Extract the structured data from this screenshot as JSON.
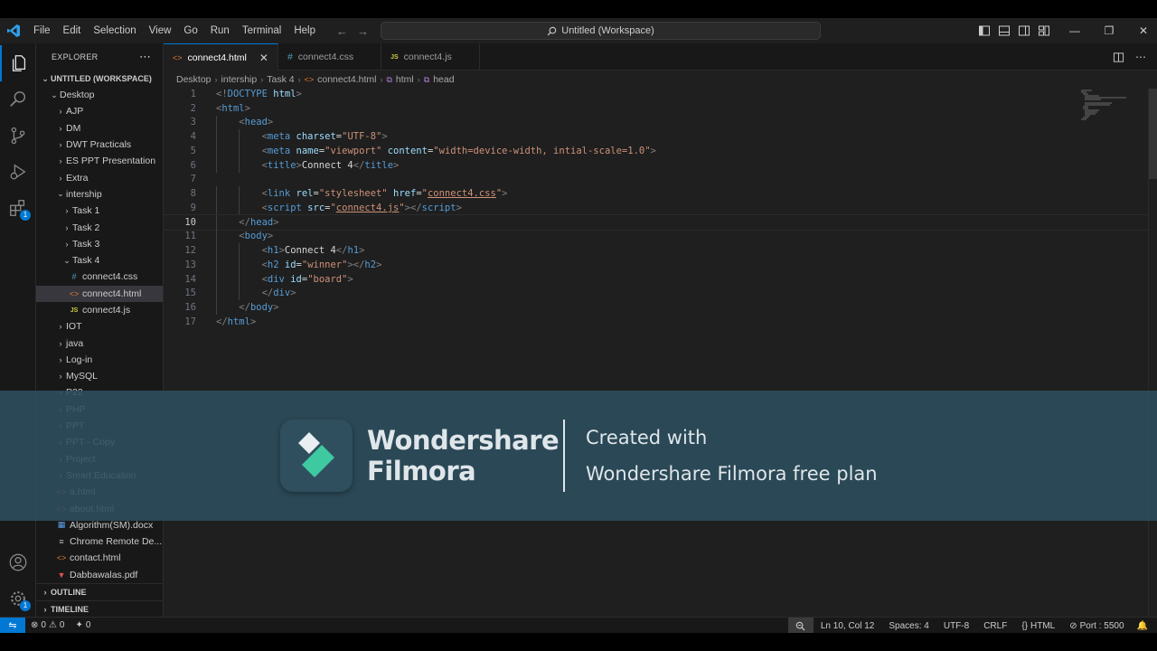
{
  "titlebar": {
    "menu": [
      "File",
      "Edit",
      "Selection",
      "View",
      "Go",
      "Run",
      "Terminal",
      "Help"
    ],
    "search_text": "Untitled (Workspace)"
  },
  "activity": {
    "extensions_badge": "1",
    "manage_badge": "1"
  },
  "explorer": {
    "header": "EXPLORER",
    "workspace": "UNTITLED (WORKSPACE)",
    "items": [
      {
        "label": "Desktop",
        "depth": 0,
        "type": "folder-open"
      },
      {
        "label": "AJP",
        "depth": 1,
        "type": "folder"
      },
      {
        "label": "DM",
        "depth": 1,
        "type": "folder"
      },
      {
        "label": "DWT Practicals",
        "depth": 1,
        "type": "folder"
      },
      {
        "label": "ES PPT Presentation",
        "depth": 1,
        "type": "folder"
      },
      {
        "label": "Extra",
        "depth": 1,
        "type": "folder"
      },
      {
        "label": "intership",
        "depth": 1,
        "type": "folder-open"
      },
      {
        "label": "Task 1",
        "depth": 2,
        "type": "folder"
      },
      {
        "label": "Task 2",
        "depth": 2,
        "type": "folder"
      },
      {
        "label": "Task 3",
        "depth": 2,
        "type": "folder"
      },
      {
        "label": "Task 4",
        "depth": 2,
        "type": "folder-open"
      },
      {
        "label": "connect4.css",
        "depth": 3,
        "type": "css"
      },
      {
        "label": "connect4.html",
        "depth": 3,
        "type": "html",
        "selected": true
      },
      {
        "label": "connect4.js",
        "depth": 3,
        "type": "js"
      },
      {
        "label": "IOT",
        "depth": 1,
        "type": "folder"
      },
      {
        "label": "java",
        "depth": 1,
        "type": "folder"
      },
      {
        "label": "Log-in",
        "depth": 1,
        "type": "folder"
      },
      {
        "label": "MySQL",
        "depth": 1,
        "type": "folder"
      },
      {
        "label": "P22",
        "depth": 1,
        "type": "folder"
      },
      {
        "label": "PHP",
        "depth": 1,
        "type": "folder"
      },
      {
        "label": "PPT",
        "depth": 1,
        "type": "folder"
      },
      {
        "label": "PPT - Copy",
        "depth": 1,
        "type": "folder"
      },
      {
        "label": "Project",
        "depth": 1,
        "type": "folder"
      },
      {
        "label": "Smart Education",
        "depth": 1,
        "type": "folder"
      },
      {
        "label": "a.html",
        "depth": 1,
        "type": "html"
      },
      {
        "label": "about.html",
        "depth": 1,
        "type": "html"
      },
      {
        "label": "Algorithm(SM).docx",
        "depth": 1,
        "type": "doc"
      },
      {
        "label": "Chrome Remote De...",
        "depth": 1,
        "type": "file"
      },
      {
        "label": "contact.html",
        "depth": 1,
        "type": "html"
      },
      {
        "label": "Dabbawalas.pdf",
        "depth": 1,
        "type": "pdf"
      }
    ],
    "outline": "OUTLINE",
    "timeline": "TIMELINE"
  },
  "tabs": [
    {
      "label": "connect4.html",
      "icon": "html",
      "active": true
    },
    {
      "label": "connect4.css",
      "icon": "css",
      "active": false
    },
    {
      "label": "connect4.js",
      "icon": "js",
      "active": false
    }
  ],
  "breadcrumb": [
    "Desktop",
    "intership",
    "Task 4",
    "connect4.html",
    "html",
    "head"
  ],
  "code_lines": [
    {
      "n": "1",
      "html": "<span class=\"p\">&lt;!</span><span class=\"t\">DOCTYPE</span> <span class=\"a\">html</span><span class=\"p\">&gt;</span>"
    },
    {
      "n": "2",
      "html": "<span class=\"p\">&lt;</span><span class=\"t\">html</span><span class=\"p\">&gt;</span>"
    },
    {
      "n": "3",
      "html": "    <span class=\"p\">&lt;</span><span class=\"t\">head</span><span class=\"p\">&gt;</span>"
    },
    {
      "n": "4",
      "html": "        <span class=\"p\">&lt;</span><span class=\"t\">meta</span> <span class=\"a\">charset</span>=<span class=\"s\">\"UTF-8\"</span><span class=\"p\">&gt;</span>"
    },
    {
      "n": "5",
      "html": "        <span class=\"p\">&lt;</span><span class=\"t\">meta</span> <span class=\"a\">name</span>=<span class=\"s\">\"viewport\"</span> <span class=\"a\">content</span>=<span class=\"s\">\"width=device-width, intial-scale=1.0\"</span><span class=\"p\">&gt;</span>"
    },
    {
      "n": "6",
      "html": "        <span class=\"p\">&lt;</span><span class=\"t\">title</span><span class=\"p\">&gt;</span>Connect 4<span class=\"p\">&lt;/</span><span class=\"t\">title</span><span class=\"p\">&gt;</span>"
    },
    {
      "n": "7",
      "html": ""
    },
    {
      "n": "8",
      "html": "        <span class=\"p\">&lt;</span><span class=\"t\">link</span> <span class=\"a\">rel</span>=<span class=\"s\">\"stylesheet\"</span> <span class=\"a\">href</span>=<span class=\"s\">\"<span class=\"u\">connect4.css</span>\"</span><span class=\"p\">&gt;</span>"
    },
    {
      "n": "9",
      "html": "        <span class=\"p\">&lt;</span><span class=\"t\">script</span> <span class=\"a\">src</span>=<span class=\"s\">\"<span class=\"u\">connect4.js</span>\"</span><span class=\"p\">&gt;&lt;/</span><span class=\"t\">script</span><span class=\"p\">&gt;</span>"
    },
    {
      "n": "10",
      "html": "    <span class=\"p\">&lt;/</span><span class=\"t\">head</span><span class=\"p\">&gt;</span>",
      "current": true
    },
    {
      "n": "11",
      "html": "    <span class=\"p\">&lt;</span><span class=\"t\">body</span><span class=\"p\">&gt;</span>"
    },
    {
      "n": "12",
      "html": "        <span class=\"p\">&lt;</span><span class=\"t\">h1</span><span class=\"p\">&gt;</span>Connect 4<span class=\"p\">&lt;/</span><span class=\"t\">h1</span><span class=\"p\">&gt;</span>"
    },
    {
      "n": "13",
      "html": "        <span class=\"p\">&lt;</span><span class=\"t\">h2</span> <span class=\"a\">id</span>=<span class=\"s\">\"winner\"</span><span class=\"p\">&gt;&lt;/</span><span class=\"t\">h2</span><span class=\"p\">&gt;</span>"
    },
    {
      "n": "14",
      "html": "        <span class=\"p\">&lt;</span><span class=\"t\">div</span> <span class=\"a\">id</span>=<span class=\"s\">\"board\"</span><span class=\"p\">&gt;</span>"
    },
    {
      "n": "15",
      "html": "        <span class=\"p\">&lt;/</span><span class=\"t\">div</span><span class=\"p\">&gt;</span>"
    },
    {
      "n": "16",
      "html": "    <span class=\"p\">&lt;/</span><span class=\"t\">body</span><span class=\"p\">&gt;</span>"
    },
    {
      "n": "17",
      "html": "<span class=\"p\">&lt;/</span><span class=\"t\">html</span><span class=\"p\">&gt;</span>"
    }
  ],
  "status": {
    "errors": "0",
    "warnings": "0",
    "ports": "0",
    "position": "Ln 10, Col 12",
    "spaces": "Spaces: 4",
    "encoding": "UTF-8",
    "eol": "CRLF",
    "language": "HTML",
    "port": "Port : 5500"
  },
  "watermark": {
    "brand_line1": "Wondershare",
    "brand_line2": "Filmora",
    "created": "Created with",
    "plan": "Wondershare Filmora free plan"
  },
  "colors": {
    "accent": "#0078d4",
    "editor_bg": "#1f1f1f",
    "sidebar_bg": "#181818",
    "watermark_bg": "#2e4e5e",
    "filmora_green": "#3ec9a0"
  }
}
